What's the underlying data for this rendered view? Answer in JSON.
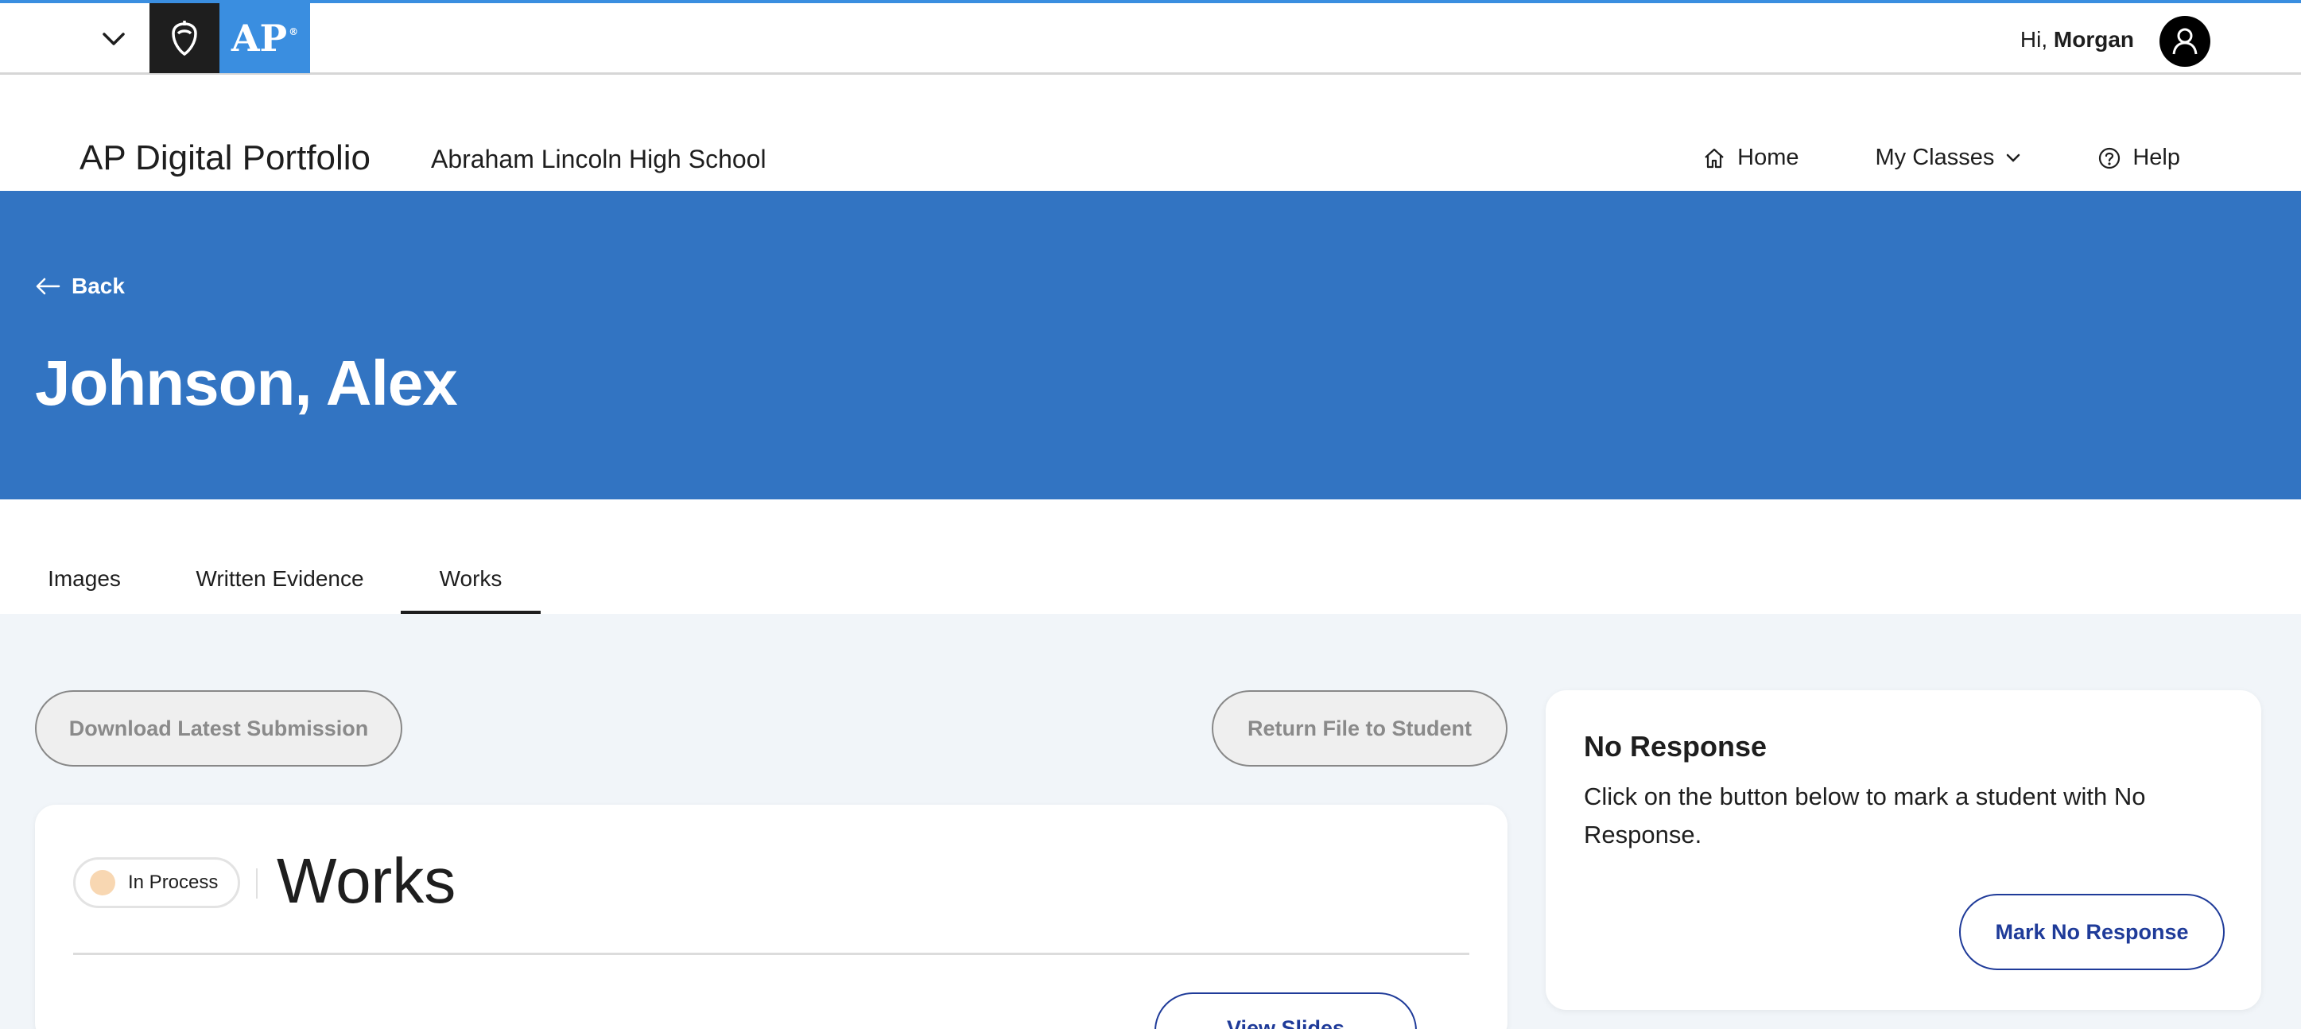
{
  "topbar": {
    "menu_icon": "chevron-down-icon",
    "collegeboard_icon": "acorn-shield-icon",
    "ap_logo_text": "AP",
    "ap_logo_mark": "®",
    "greeting_prefix": "Hi, ",
    "user_name": "Morgan",
    "avatar_icon": "user-icon"
  },
  "header": {
    "site_title": "AP Digital Portfolio",
    "school_name": "Abraham Lincoln High School",
    "nav": [
      {
        "label": "Home",
        "icon": "home-icon"
      },
      {
        "label": "My Classes",
        "icon": "chevron-down-icon"
      },
      {
        "label": "Help",
        "icon": "help-circle-icon"
      }
    ]
  },
  "hero": {
    "back_label": "Back",
    "student_name": "Johnson, Alex",
    "background_color": "#3274c2"
  },
  "tabs": [
    {
      "label": "Images",
      "active": false
    },
    {
      "label": "Written Evidence",
      "active": false
    },
    {
      "label": "Works",
      "active": true
    }
  ],
  "actions": {
    "download_label": "Download Latest Submission",
    "return_label": "Return File to Student"
  },
  "work_card": {
    "status_label": "In Process",
    "status_color": "#f8d7b2",
    "title": "Works",
    "view_button_label": "View Slides"
  },
  "no_response": {
    "title": "No Response",
    "description": "Click on the button below to mark a student with No Response.",
    "button_label": "Mark No Response"
  },
  "colors": {
    "accent_blue": "#3a8ee0",
    "link_blue": "#1f3b99",
    "content_bg": "#f1f5f9"
  }
}
